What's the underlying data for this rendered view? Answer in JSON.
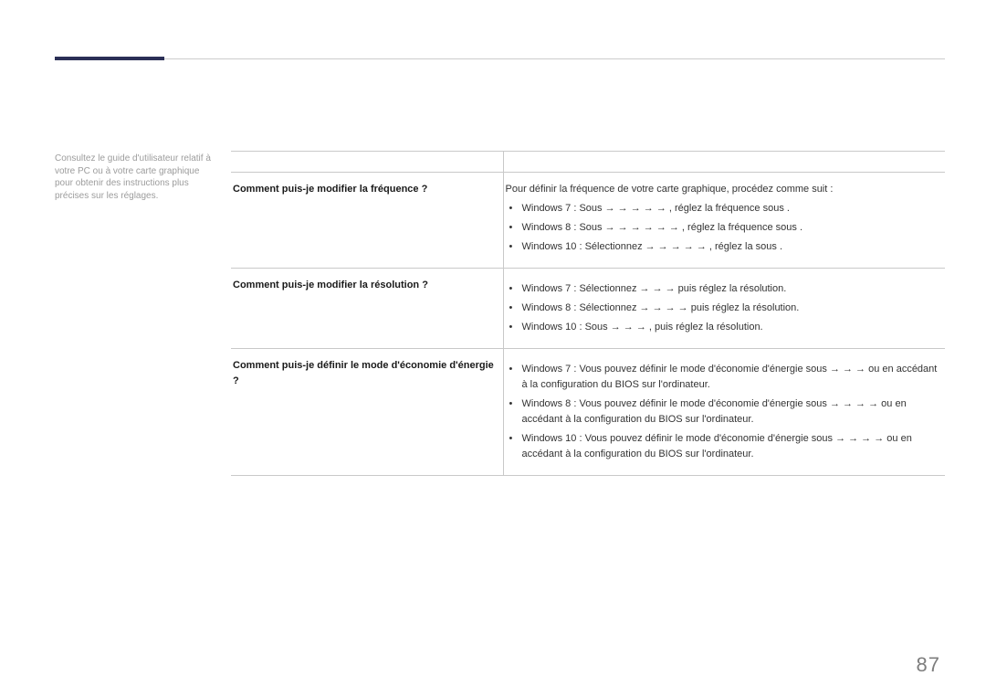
{
  "page_number": "87",
  "sidebar": {
    "note": "Consultez le guide d'utilisateur relatif à votre PC ou à votre carte graphique pour obtenir des instructions plus précises sur les réglages."
  },
  "table": {
    "header": {
      "q": "",
      "a": ""
    },
    "rows": [
      {
        "question": "Comment puis-je modifier la fréquence ?",
        "answer_intro": "Pour définir la fréquence de votre carte graphique, procédez comme suit :",
        "items": [
          "Windows 7 : Sous  →  →  →  →  →                                                                                , réglez la fréquence sous .",
          "Windows 8 : Sous  →                          →                                                          →  →  →  → , réglez la fréquence sous .",
          "Windows 10 : Sélectionnez  →  →  →                                                          →                                                                        → , réglez la                              sous ."
        ]
      },
      {
        "question": "Comment puis-je modifier la résolution ?",
        "answer_intro": "",
        "items": [
          "Windows 7 : Sélectionnez  →  →                                                  →  puis réglez la résolution.",
          "Windows 8 : Sélectionnez  →  →                                                  →  →  puis réglez la résolution.",
          "Windows 10 : Sous  →  →  → ,                                                   puis réglez la résolution."
        ]
      },
      {
        "question": "Comment puis-je définir le mode d'économie d'énergie ?",
        "answer_intro": "",
        "items": [
          "Windows 7 : Vous pouvez définir le mode d'économie d'énergie sous  →  →  →                                                                                                                            ou en accédant à la configuration du BIOS sur l'ordinateur.",
          "Windows 8 : Vous pouvez définir le mode d'économie d'énergie sous  →  →  →                                                                                   →                                         ou en accédant à la configuration du BIOS sur l'ordinateur.",
          "Windows 10 : Vous pouvez définir le mode d'économie d'énergie sous  →  →  →                                                                                   →                                        ou en accédant à la configuration du BIOS sur l'ordinateur."
        ]
      }
    ]
  }
}
